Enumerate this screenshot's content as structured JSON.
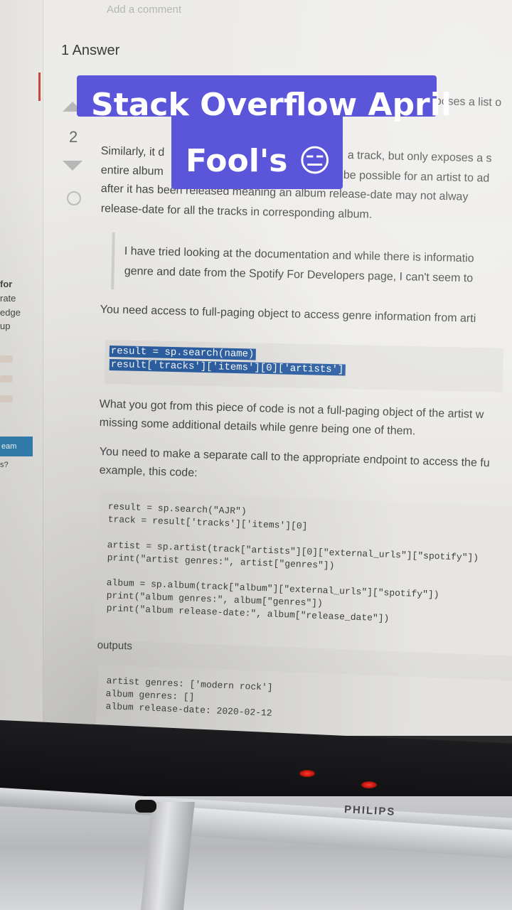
{
  "screen": {
    "add_comment": "Add a comment",
    "answers_heading": "1 Answer",
    "vote_count": "2",
    "side_texts": [
      "for",
      "rate",
      "edge",
      "up",
      "eam",
      "s?"
    ],
    "paragraphs": [
      "poses a list o",
      "Similarly, it d",
      "a track, but only exposes a s",
      "entire album",
      "be possible for an artist to ad",
      "after it has been released meaning an album release-date may not alway",
      "release-date for all the tracks in corresponding album."
    ],
    "quote_lines": [
      "I have tried looking at the documentation and while there is informatio",
      "genre and date from the Spotify For Developers page, I can't seem to"
    ],
    "para_access": "You need access to full-paging object to access genre information from arti",
    "highlight_code": [
      "result = sp.search(name)",
      "result['tracks']['items'][0]['artists']"
    ],
    "para_got": [
      "What you got from this piece of code is not a full-paging object of the artist w",
      "missing some additional details while genre being one of them."
    ],
    "para_separate": [
      "You need to make a separate call to the appropriate endpoint to access the fu",
      "example, this code:"
    ],
    "code_lines": [
      "result = sp.search(\"AJR\")",
      "track = result['tracks']['items'][0]",
      "artist = sp.artist(track[\"artists\"][0][\"external_urls\"][\"spotify\"])",
      "print(\"artist genres:\", artist[\"genres\"])",
      "album = sp.album(track[\"album\"][\"external_urls\"][\"spotify\"])",
      "print(\"album genres:\", album[\"genres\"])",
      "print(\"album release-date:\", album[\"release_date\"])"
    ],
    "outputs_label": "outputs",
    "output_lines": [
      "artist genres: ['modern rock']",
      "album genres: []",
      "album release-date: 2020-02-12"
    ]
  },
  "monitor": {
    "brand": "PHILIPS",
    "led_color": "#ff3b2f"
  },
  "caption": {
    "line1": "Stack Overflow April",
    "line2": "Fool's 😑",
    "background": "#5a55d9"
  }
}
